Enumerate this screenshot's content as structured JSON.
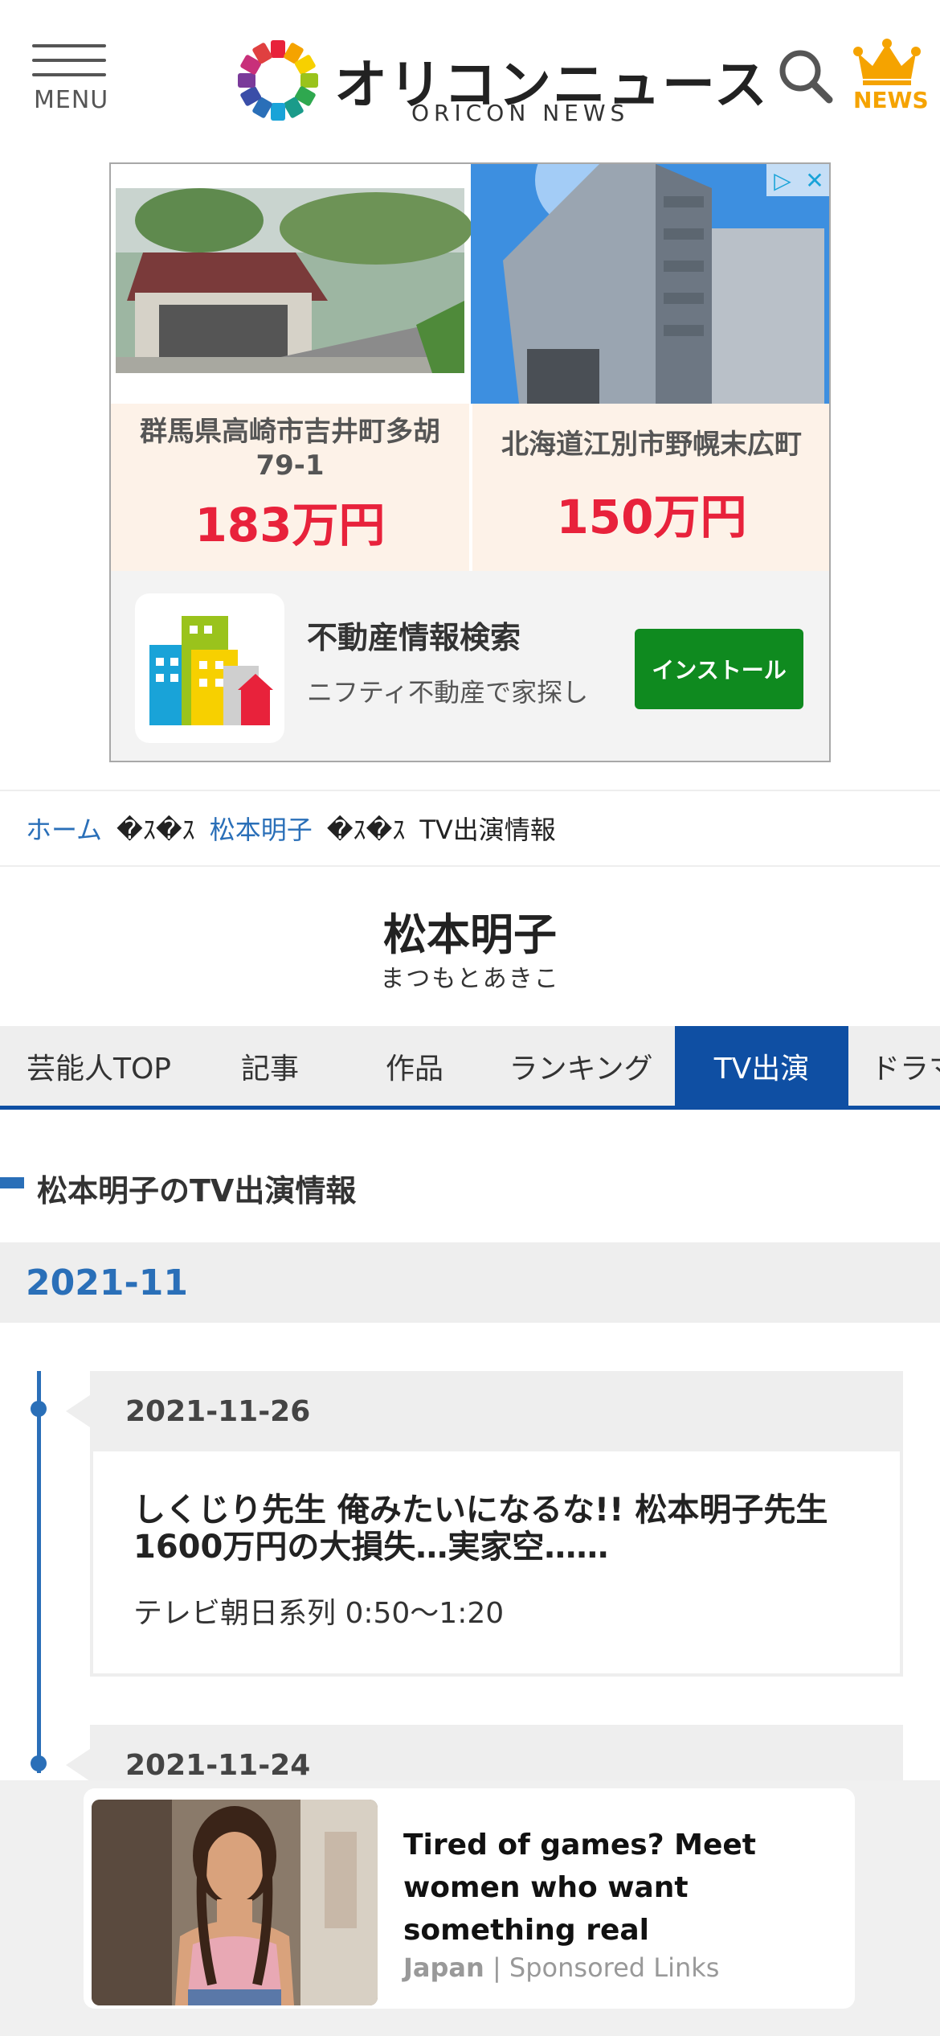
{
  "header": {
    "menu_label": "MENU",
    "logo_jp": "オリコンニュース",
    "logo_en": "ORICON NEWS",
    "crown_label": "NEWS",
    "colors": {
      "crown": "#f5a300",
      "accent": "#2a6fb8"
    }
  },
  "ad_top": {
    "badge_icons": [
      "adchoices-icon",
      "close-icon"
    ],
    "properties": [
      {
        "address": "群馬県高崎市吉井町多胡\n79-1",
        "price": "183万円"
      },
      {
        "address": "北海道江別市野幌末広町",
        "price": "150万円"
      }
    ],
    "app": {
      "title": "不動産情報検索",
      "subtitle": "ニフティ不動産で家探し",
      "install_label": "インストール"
    }
  },
  "breadcrumb": {
    "home": "ホーム",
    "sep": "�ｽ�ｽ",
    "person": "松本明子",
    "current": "TV出演情報"
  },
  "person": {
    "name": "松本明子",
    "kana": "まつもとあきこ"
  },
  "tabs": [
    {
      "label": "芸能人TOP",
      "active": false
    },
    {
      "label": "記事",
      "active": false
    },
    {
      "label": "作品",
      "active": false
    },
    {
      "label": "ランキング",
      "active": false
    },
    {
      "label": "TV出演",
      "active": true
    },
    {
      "label": "ドラマ",
      "active": false
    }
  ],
  "section": {
    "title": "松本明子のTV出演情報",
    "month": "2021-11"
  },
  "entries": [
    {
      "date": "2021-11-26",
      "title": "しくじり先生 俺みたいになるな!! 松本明子先生1600万円の大損失…実家空……",
      "channel": "テレビ朝日系列 0:50〜1:20"
    },
    {
      "date": "2021-11-24"
    }
  ],
  "bottom_ad": {
    "title": "Tired of games? Meet women who want something real",
    "source": "Japan",
    "source_sep": "|",
    "sponsor": "Sponsored Links"
  }
}
